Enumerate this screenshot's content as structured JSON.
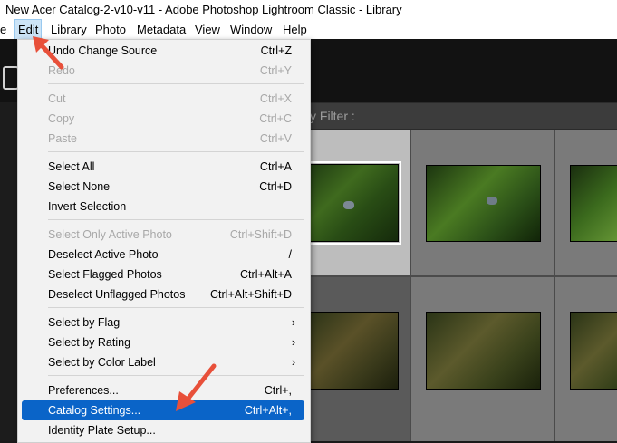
{
  "window": {
    "title": "New Acer Catalog-2-v10-v11 - Adobe Photoshop Lightroom Classic - Library"
  },
  "menubar": {
    "items": [
      {
        "label": "e"
      },
      {
        "label": "Edit"
      },
      {
        "label": "Library"
      },
      {
        "label": "Photo"
      },
      {
        "label": "Metadata"
      },
      {
        "label": "View"
      },
      {
        "label": "Window"
      },
      {
        "label": "Help"
      }
    ]
  },
  "filterbar": {
    "label": "y Filter :"
  },
  "edit_menu": {
    "items": [
      {
        "label": "Undo Change Source",
        "shortcut": "Ctrl+Z",
        "enabled": true
      },
      {
        "label": "Redo",
        "shortcut": "Ctrl+Y",
        "enabled": false
      },
      {
        "label": "Cut",
        "shortcut": "Ctrl+X",
        "enabled": false
      },
      {
        "label": "Copy",
        "shortcut": "Ctrl+C",
        "enabled": false
      },
      {
        "label": "Paste",
        "shortcut": "Ctrl+V",
        "enabled": false
      },
      {
        "label": "Select All",
        "shortcut": "Ctrl+A",
        "enabled": true
      },
      {
        "label": "Select None",
        "shortcut": "Ctrl+D",
        "enabled": true
      },
      {
        "label": "Invert Selection",
        "shortcut": "",
        "enabled": true
      },
      {
        "label": "Select Only Active Photo",
        "shortcut": "Ctrl+Shift+D",
        "enabled": false
      },
      {
        "label": "Deselect Active Photo",
        "shortcut": "/",
        "enabled": true
      },
      {
        "label": "Select Flagged Photos",
        "shortcut": "Ctrl+Alt+A",
        "enabled": true
      },
      {
        "label": "Deselect Unflagged Photos",
        "shortcut": "Ctrl+Alt+Shift+D",
        "enabled": true
      },
      {
        "label": "Select by Flag",
        "submenu_icon": "chevron-right-icon",
        "submenu_glyph": "›",
        "enabled": true
      },
      {
        "label": "Select by Rating",
        "submenu_icon": "chevron-right-icon",
        "submenu_glyph": "›",
        "enabled": true
      },
      {
        "label": "Select by Color Label",
        "submenu_icon": "chevron-right-icon",
        "submenu_glyph": "›",
        "enabled": true
      },
      {
        "label": "Preferences...",
        "shortcut": "Ctrl+,",
        "enabled": true
      },
      {
        "label": "Catalog Settings...",
        "shortcut": "Ctrl+Alt+,",
        "enabled": true,
        "highlighted": true
      },
      {
        "label": "Identity Plate Setup...",
        "shortcut": "",
        "enabled": true
      }
    ]
  },
  "colors": {
    "menu_highlight": "#0a64c8",
    "annotation_arrow": "#e8503a",
    "menubar_active": "#cce4f7"
  }
}
